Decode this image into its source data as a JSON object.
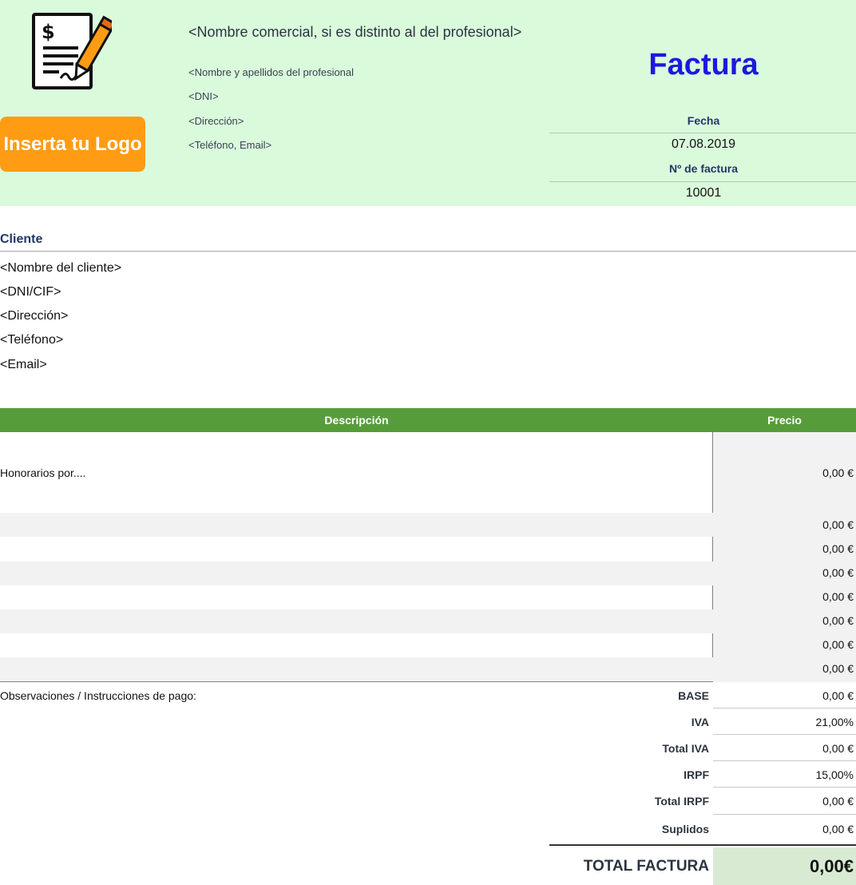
{
  "header": {
    "logo_button": "Inserta tu Logo",
    "company_name": "<Nombre comercial, si es distinto al del profesional>",
    "professional_lines": [
      "<Nombre y apellidos del profesional",
      "<DNI>",
      "<Dirección>",
      "<Teléfono, Email>"
    ],
    "title": "Factura",
    "date_label": "Fecha",
    "date_value": "07.08.2019",
    "invoice_number_label": "Nº de factura",
    "invoice_number_value": "10001",
    "icon": "invoice-signing-icon"
  },
  "client": {
    "heading": "Cliente",
    "lines": [
      "<Nombre del cliente>",
      "<DNI/CIF>",
      "<Dirección>",
      "<Teléfono>",
      "<Email>"
    ]
  },
  "items": {
    "columns": [
      "Descripción",
      "Precio"
    ],
    "rows": [
      {
        "description": "Honorarios por....",
        "price": "0,00 €"
      },
      {
        "description": "",
        "price": "0,00 €"
      },
      {
        "description": "",
        "price": "0,00 €"
      },
      {
        "description": "",
        "price": "0,00 €"
      },
      {
        "description": "",
        "price": "0,00 €"
      },
      {
        "description": "",
        "price": "0,00 €"
      },
      {
        "description": "",
        "price": "0,00 €"
      },
      {
        "description": "",
        "price": "0,00 €"
      }
    ]
  },
  "observations_label": "Observaciones / Instrucciones de pago:",
  "totals": [
    {
      "label": "BASE",
      "value": "0,00 €"
    },
    {
      "label": "IVA",
      "value": "21,00%"
    },
    {
      "label": "Total IVA",
      "value": "0,00 €"
    },
    {
      "label": "IRPF",
      "value": "15,00%"
    },
    {
      "label": "Total IRPF",
      "value": "0,00 €"
    },
    {
      "label": "Suplidos",
      "value": "0,00 €"
    }
  ],
  "grand_total": {
    "label": "TOTAL FACTURA",
    "value": "0,00€"
  },
  "colors": {
    "header_bg": "#dafadc",
    "logo_button": "#ff9c14",
    "title": "#1a1adf",
    "table_header": "#579c3a",
    "grand_total_bg": "#d9ead3"
  }
}
